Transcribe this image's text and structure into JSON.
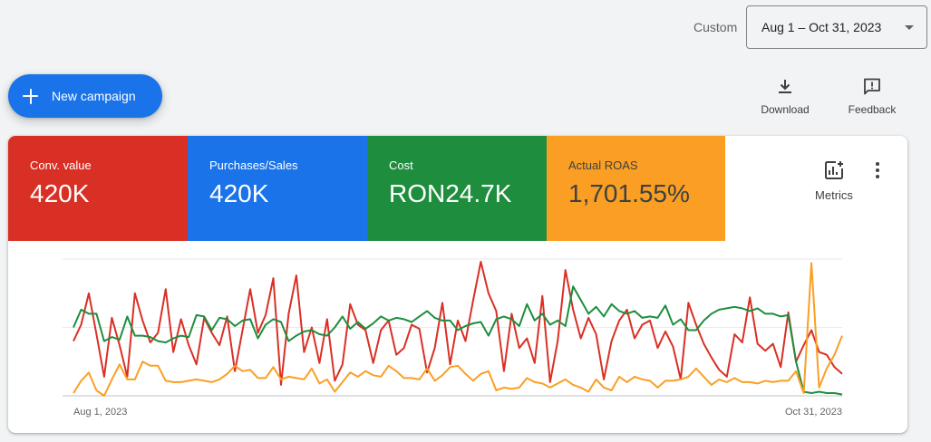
{
  "date_range": {
    "label": "Custom",
    "value": "Aug 1 – Oct 31, 2023"
  },
  "toolbar": {
    "new_campaign_label": "New campaign",
    "download_label": "Download",
    "feedback_label": "Feedback"
  },
  "scorecards": [
    {
      "label": "Conv. value",
      "value": "420K",
      "color": "#d93025"
    },
    {
      "label": "Purchases/Sales",
      "value": "420K",
      "color": "#1a73e8"
    },
    {
      "label": "Cost",
      "value": "RON24.7K",
      "color": "#1e8e3e"
    },
    {
      "label": "Actual ROAS",
      "value": "1,701.55%",
      "color": "#fa9f24"
    }
  ],
  "metrics_label": "Metrics",
  "chart_data": {
    "type": "line",
    "x_start_label": "Aug 1, 2023",
    "x_end_label": "Oct 31, 2023",
    "ylim": [
      0,
      100
    ],
    "series": [
      {
        "color": "#d93025",
        "values": [
          40,
          52,
          75,
          45,
          14,
          57,
          37,
          14,
          75,
          55,
          39,
          46,
          78,
          32,
          56,
          37,
          23,
          57,
          46,
          37,
          58,
          18,
          48,
          78,
          46,
          59,
          86,
          8,
          60,
          88,
          32,
          50,
          24,
          56,
          11,
          23,
          67,
          52,
          48,
          24,
          48,
          55,
          30,
          35,
          52,
          49,
          17,
          35,
          68,
          23,
          55,
          40,
          70,
          98,
          75,
          62,
          18,
          60,
          35,
          42,
          24,
          73,
          10,
          40,
          92,
          63,
          42,
          57,
          45,
          12,
          40,
          55,
          63,
          42,
          52,
          55,
          35,
          47,
          36,
          12,
          68,
          52,
          38,
          28,
          19,
          14,
          45,
          39,
          72,
          38,
          33,
          38,
          21,
          61,
          25,
          37,
          48,
          32,
          30,
          21,
          16
        ]
      },
      {
        "color": "#1e8e3e",
        "values": [
          50,
          63,
          60,
          60,
          40,
          43,
          41,
          58,
          44,
          44,
          43,
          40,
          39,
          42,
          44,
          43,
          59,
          58,
          48,
          57,
          56,
          51,
          55,
          56,
          42,
          52,
          56,
          54,
          40,
          44,
          47,
          48,
          45,
          44,
          50,
          58,
          49,
          54,
          49,
          53,
          58,
          55,
          57,
          56,
          54,
          58,
          62,
          57,
          55,
          55,
          48,
          51,
          53,
          54,
          44,
          56,
          58,
          56,
          51,
          67,
          55,
          60,
          52,
          55,
          51,
          80,
          70,
          60,
          65,
          58,
          67,
          62,
          60,
          62,
          57,
          58,
          57,
          66,
          52,
          56,
          48,
          48,
          55,
          60,
          63,
          64,
          65,
          64,
          62,
          64,
          60,
          60,
          58,
          59,
          25,
          3,
          2,
          3,
          2,
          2,
          1
        ]
      },
      {
        "color": "#fa9f24",
        "values": [
          2,
          11,
          17,
          4,
          0,
          12,
          23,
          12,
          12,
          25,
          22,
          22,
          11,
          10,
          10,
          11,
          12,
          11,
          10,
          12,
          16,
          22,
          18,
          19,
          13,
          13,
          21,
          12,
          14,
          13,
          12,
          20,
          9,
          12,
          3,
          10,
          17,
          14,
          18,
          15,
          14,
          22,
          18,
          13,
          13,
          12,
          20,
          11,
          15,
          21,
          22,
          16,
          11,
          16,
          18,
          4,
          6,
          5,
          6,
          13,
          10,
          9,
          6,
          9,
          12,
          8,
          6,
          3,
          12,
          6,
          4,
          14,
          10,
          14,
          12,
          11,
          6,
          11,
          11,
          12,
          14,
          20,
          14,
          8,
          12,
          10,
          13,
          10,
          10,
          9,
          11,
          10,
          11,
          11,
          18,
          2,
          97,
          6,
          20,
          30,
          44
        ]
      }
    ]
  }
}
